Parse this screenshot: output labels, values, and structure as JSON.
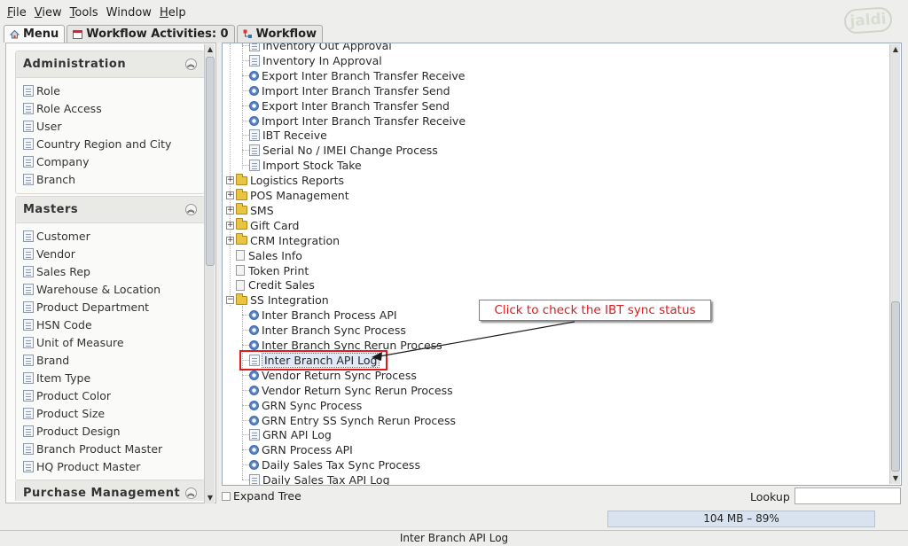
{
  "menubar": {
    "items": [
      {
        "label": "File",
        "mnemonic_index": 0
      },
      {
        "label": "View",
        "mnemonic_index": 0
      },
      {
        "label": "Tools",
        "mnemonic_index": 0
      },
      {
        "label": "Window",
        "mnemonic_index": -1
      },
      {
        "label": "Help",
        "mnemonic_index": 0
      }
    ]
  },
  "logo": {
    "text": "jaldi"
  },
  "tabs": [
    {
      "label": "Menu",
      "icon": "home-icon"
    },
    {
      "label": "Workflow Activities: 0",
      "icon": "calendar-icon"
    },
    {
      "label": "Workflow",
      "icon": "workflow-icon"
    }
  ],
  "sidebar": {
    "sections": [
      {
        "title": "Administration",
        "items": [
          "Role",
          "Role Access",
          "User",
          "Country Region and City",
          "Company",
          "Branch"
        ]
      },
      {
        "title": "Masters",
        "items": [
          "Customer",
          "Vendor",
          "Sales Rep",
          "Warehouse & Location",
          "Product Department",
          "HSN Code",
          "Unit of Measure",
          "Brand",
          "Item Type",
          "Product Color",
          "Product Size",
          "Product Design",
          "Branch Product Master",
          "HQ Product Master"
        ]
      },
      {
        "title": "Purchase Management",
        "items": []
      }
    ]
  },
  "tree": {
    "nodes": [
      {
        "label": "Inventory Out Approval",
        "icon": "doc",
        "level": 2
      },
      {
        "label": "Inventory In Approval",
        "icon": "doc",
        "level": 2
      },
      {
        "label": "Export Inter Branch Transfer Receive",
        "icon": "process",
        "level": 2
      },
      {
        "label": "Import Inter Branch Transfer Send",
        "icon": "process",
        "level": 2
      },
      {
        "label": "Export Inter Branch Transfer Send",
        "icon": "process",
        "level": 2
      },
      {
        "label": "Import Inter Branch Transfer Receive",
        "icon": "process",
        "level": 2
      },
      {
        "label": "IBT Receive",
        "icon": "doc",
        "level": 2
      },
      {
        "label": "Serial No / IMEI Change Process",
        "icon": "doc",
        "level": 2
      },
      {
        "label": "Import Stock Take",
        "icon": "doc",
        "level": 2
      },
      {
        "label": "Logistics Reports",
        "icon": "folder",
        "level": 1,
        "expander": "+"
      },
      {
        "label": "POS Management",
        "icon": "folder",
        "level": 1,
        "expander": "+"
      },
      {
        "label": "SMS",
        "icon": "folder",
        "level": 1,
        "expander": "+"
      },
      {
        "label": "Gift Card",
        "icon": "folder",
        "level": 1,
        "expander": "+"
      },
      {
        "label": "CRM Integration",
        "icon": "folder",
        "level": 1,
        "expander": "+"
      },
      {
        "label": "Sales Info",
        "icon": "page",
        "level": 1
      },
      {
        "label": "Token Print",
        "icon": "page",
        "level": 1
      },
      {
        "label": "Credit Sales",
        "icon": "page",
        "level": 1
      },
      {
        "label": "SS Integration",
        "icon": "folder",
        "level": 1,
        "expander": "-"
      },
      {
        "label": "Inter Branch Process API",
        "icon": "process",
        "level": 2
      },
      {
        "label": "Inter Branch Sync Process",
        "icon": "process",
        "level": 2
      },
      {
        "label": "Inter Branch Sync Rerun Process",
        "icon": "process",
        "level": 2
      },
      {
        "label": "Inter Branch API Log",
        "icon": "doc",
        "level": 2,
        "selected": true
      },
      {
        "label": "Vendor Return Sync Process",
        "icon": "process",
        "level": 2
      },
      {
        "label": "Vendor Return Sync Rerun Process",
        "icon": "process",
        "level": 2
      },
      {
        "label": "GRN Sync Process",
        "icon": "process",
        "level": 2
      },
      {
        "label": "GRN Entry SS Synch Rerun Process",
        "icon": "process",
        "level": 2
      },
      {
        "label": "GRN API Log",
        "icon": "doc",
        "level": 2
      },
      {
        "label": "GRN Process API",
        "icon": "process",
        "level": 2
      },
      {
        "label": "Daily Sales Tax Sync Process",
        "icon": "process",
        "level": 2
      },
      {
        "label": "Daily Sales Tax API Log",
        "icon": "doc",
        "level": 2
      }
    ]
  },
  "annotation": {
    "text": "Click to check the IBT sync status",
    "color": "#e0191d"
  },
  "footer": {
    "expand_tree": "Expand Tree",
    "lookup_label": "Lookup",
    "lookup_value": "",
    "memory": "104 MB – 89%",
    "status": "Inter Branch API Log"
  }
}
